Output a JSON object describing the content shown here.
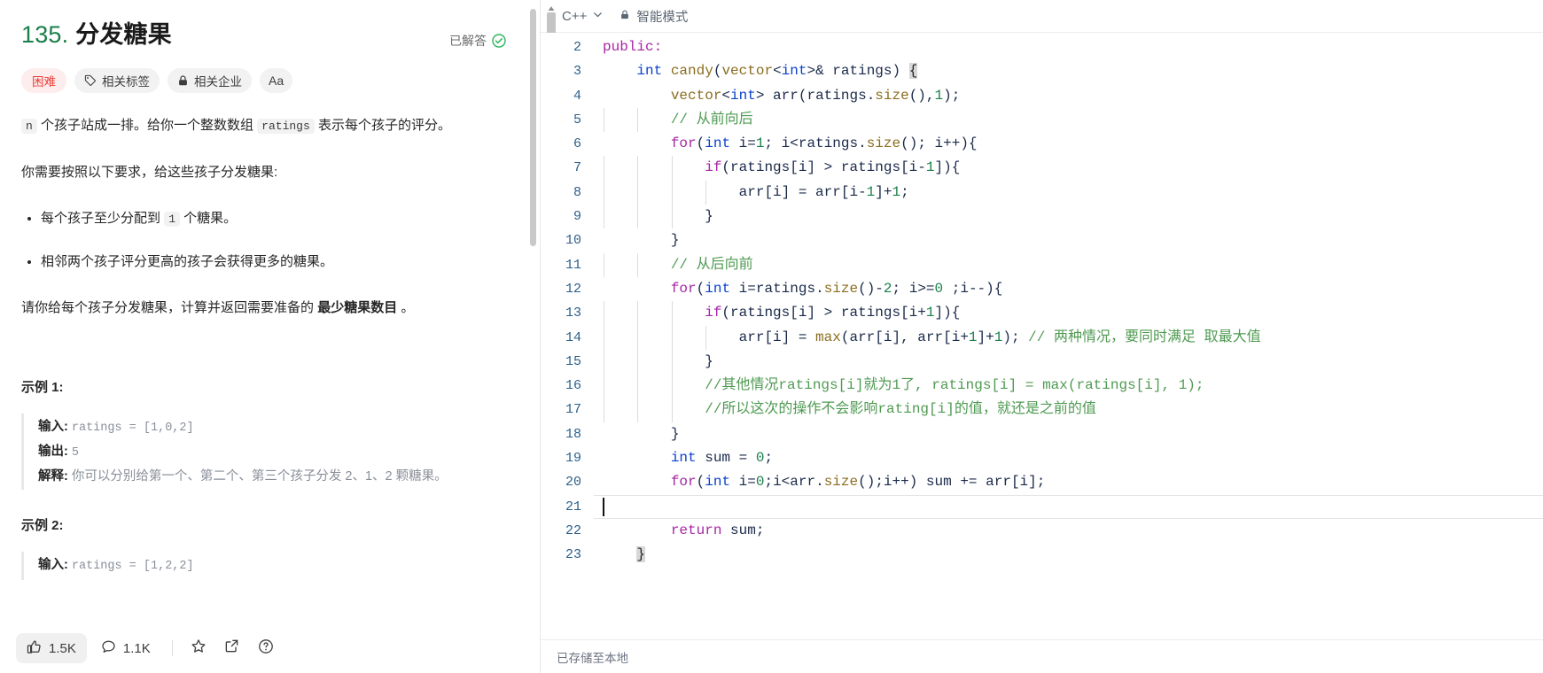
{
  "problem": {
    "number": "135.",
    "title": "分发糖果",
    "solved_label": "已解答",
    "tags": [
      {
        "name": "difficulty-badge",
        "label": "困难",
        "icon": ""
      },
      {
        "name": "topics-button",
        "label": "相关标签",
        "icon": "tag-icon"
      },
      {
        "name": "companies-button",
        "label": "相关企业",
        "icon": "lock-icon"
      },
      {
        "name": "font-size-button",
        "label": "Aa",
        "icon": "font-size-icon"
      }
    ],
    "paragraph_1_pre": "",
    "code_n": "n",
    "paragraph_1_a": "个孩子站成一排。给你一个整数数组",
    "code_ratings": "ratings",
    "paragraph_1_b": "表示每个孩子的评分。",
    "paragraph_2": "你需要按照以下要求，给这些孩子分发糖果:",
    "bullet_1_a": "每个孩子至少分配到",
    "code_one": "1",
    "bullet_1_b": "个糖果。",
    "bullet_2": "相邻两个孩子评分更高的孩子会获得更多的糖果。",
    "paragraph_3_a": "请你给每个孩子分发糖果，计算并返回需要准备的",
    "paragraph_3_bold": "最少糖果数目",
    "paragraph_3_b": "。",
    "examples": [
      {
        "heading": "示例 1:",
        "input_label": "输入:",
        "input_value": "ratings = [1,0,2]",
        "output_label": "输出:",
        "output_value": "5",
        "explain_label": "解释:",
        "explain_value": "你可以分别给第一个、第二个、第三个孩子分发 2、1、2 颗糖果。"
      },
      {
        "heading": "示例 2:",
        "input_label": "输入:",
        "input_value": "ratings = [1,2,2]"
      }
    ]
  },
  "footer": {
    "like_count": "1.5K",
    "comment_count": "1.1K",
    "like_icon": "thumbs-up-icon",
    "comment_icon": "comment-icon",
    "star_icon": "star-icon",
    "share_icon": "share-icon",
    "help_icon": "help-icon"
  },
  "editor": {
    "language": "C++",
    "chevron_icon": "chevron-down-icon",
    "lock_icon": "lock-icon",
    "smart_mode": "智能模式",
    "status": "已存储至本地",
    "first_line_number": 2,
    "cursor_line": 21,
    "lines": [
      {
        "n": 2,
        "indent": 0,
        "tokens": [
          {
            "t": "public:",
            "c": "k"
          }
        ]
      },
      {
        "n": 3,
        "indent": 1,
        "tokens": [
          {
            "t": "int",
            "c": "kt"
          },
          {
            "t": " ",
            "c": "op"
          },
          {
            "t": "candy",
            "c": "fn"
          },
          {
            "t": "(",
            "c": "br"
          },
          {
            "t": "vector",
            "c": "fn"
          },
          {
            "t": "<",
            "c": "op"
          },
          {
            "t": "int",
            "c": "kt"
          },
          {
            "t": ">& ",
            "c": "op"
          },
          {
            "t": "ratings",
            "c": "id"
          },
          {
            "t": ") ",
            "c": "br"
          },
          {
            "t": "{",
            "c": "match"
          }
        ]
      },
      {
        "n": 4,
        "indent": 2,
        "tokens": [
          {
            "t": "vector",
            "c": "fn"
          },
          {
            "t": "<",
            "c": "op"
          },
          {
            "t": "int",
            "c": "kt"
          },
          {
            "t": "> ",
            "c": "op"
          },
          {
            "t": "arr",
            "c": "id"
          },
          {
            "t": "(",
            "c": "br"
          },
          {
            "t": "ratings",
            "c": "id"
          },
          {
            "t": ".",
            "c": "op"
          },
          {
            "t": "size",
            "c": "fn"
          },
          {
            "t": "(),",
            "c": "br"
          },
          {
            "t": "1",
            "c": "num"
          },
          {
            "t": ");",
            "c": "br"
          }
        ]
      },
      {
        "n": 5,
        "indent": 2,
        "guide": true,
        "tokens": [
          {
            "t": "// 从前向后",
            "c": "cm"
          }
        ]
      },
      {
        "n": 6,
        "indent": 2,
        "tokens": [
          {
            "t": "for",
            "c": "k"
          },
          {
            "t": "(",
            "c": "br"
          },
          {
            "t": "int",
            "c": "kt"
          },
          {
            "t": " i=",
            "c": "op"
          },
          {
            "t": "1",
            "c": "num"
          },
          {
            "t": "; i<",
            "c": "op"
          },
          {
            "t": "ratings",
            "c": "id"
          },
          {
            "t": ".",
            "c": "op"
          },
          {
            "t": "size",
            "c": "fn"
          },
          {
            "t": "(); i++){",
            "c": "br"
          }
        ]
      },
      {
        "n": 7,
        "indent": 3,
        "guide": true,
        "tokens": [
          {
            "t": "if",
            "c": "k"
          },
          {
            "t": "(",
            "c": "br"
          },
          {
            "t": "ratings",
            "c": "id"
          },
          {
            "t": "[i] > ",
            "c": "op"
          },
          {
            "t": "ratings",
            "c": "id"
          },
          {
            "t": "[i-",
            "c": "op"
          },
          {
            "t": "1",
            "c": "num"
          },
          {
            "t": "]){",
            "c": "br"
          }
        ]
      },
      {
        "n": 8,
        "indent": 4,
        "guide": true,
        "tokens": [
          {
            "t": "arr",
            "c": "id"
          },
          {
            "t": "[i] = ",
            "c": "op"
          },
          {
            "t": "arr",
            "c": "id"
          },
          {
            "t": "[i-",
            "c": "op"
          },
          {
            "t": "1",
            "c": "num"
          },
          {
            "t": "]+",
            "c": "op"
          },
          {
            "t": "1",
            "c": "num"
          },
          {
            "t": ";",
            "c": "br"
          }
        ]
      },
      {
        "n": 9,
        "indent": 3,
        "guide": true,
        "tokens": [
          {
            "t": "}",
            "c": "br"
          }
        ]
      },
      {
        "n": 10,
        "indent": 2,
        "tokens": [
          {
            "t": "}",
            "c": "br"
          }
        ]
      },
      {
        "n": 11,
        "indent": 2,
        "guide": true,
        "tokens": [
          {
            "t": "// 从后向前",
            "c": "cm"
          }
        ]
      },
      {
        "n": 12,
        "indent": 2,
        "tokens": [
          {
            "t": "for",
            "c": "k"
          },
          {
            "t": "(",
            "c": "br"
          },
          {
            "t": "int",
            "c": "kt"
          },
          {
            "t": " i=",
            "c": "op"
          },
          {
            "t": "ratings",
            "c": "id"
          },
          {
            "t": ".",
            "c": "op"
          },
          {
            "t": "size",
            "c": "fn"
          },
          {
            "t": "()-",
            "c": "br"
          },
          {
            "t": "2",
            "c": "num"
          },
          {
            "t": "; i>=",
            "c": "op"
          },
          {
            "t": "0",
            "c": "num"
          },
          {
            "t": " ;i--){",
            "c": "br"
          }
        ]
      },
      {
        "n": 13,
        "indent": 3,
        "guide": true,
        "tokens": [
          {
            "t": "if",
            "c": "k"
          },
          {
            "t": "(",
            "c": "br"
          },
          {
            "t": "ratings",
            "c": "id"
          },
          {
            "t": "[i] > ",
            "c": "op"
          },
          {
            "t": "ratings",
            "c": "id"
          },
          {
            "t": "[i+",
            "c": "op"
          },
          {
            "t": "1",
            "c": "num"
          },
          {
            "t": "]){",
            "c": "br"
          }
        ]
      },
      {
        "n": 14,
        "indent": 4,
        "guide": true,
        "tokens": [
          {
            "t": "arr",
            "c": "id"
          },
          {
            "t": "[i] = ",
            "c": "op"
          },
          {
            "t": "max",
            "c": "fn"
          },
          {
            "t": "(",
            "c": "br"
          },
          {
            "t": "arr",
            "c": "id"
          },
          {
            "t": "[i], ",
            "c": "op"
          },
          {
            "t": "arr",
            "c": "id"
          },
          {
            "t": "[i+",
            "c": "op"
          },
          {
            "t": "1",
            "c": "num"
          },
          {
            "t": "]+",
            "c": "op"
          },
          {
            "t": "1",
            "c": "num"
          },
          {
            "t": "); ",
            "c": "br"
          },
          {
            "t": "// 两种情况，要同时满足 取最大值",
            "c": "cm"
          }
        ]
      },
      {
        "n": 15,
        "indent": 3,
        "guide": true,
        "tokens": [
          {
            "t": "}",
            "c": "br"
          }
        ]
      },
      {
        "n": 16,
        "indent": 3,
        "guide": true,
        "tokens": [
          {
            "t": "//其他情况ratings[i]就为1了, ratings[i] = max(ratings[i], 1);",
            "c": "cm"
          }
        ]
      },
      {
        "n": 17,
        "indent": 3,
        "guide": true,
        "tokens": [
          {
            "t": "//所以这次的操作不会影响rating[i]的值，就还是之前的值",
            "c": "cm"
          }
        ]
      },
      {
        "n": 18,
        "indent": 2,
        "tokens": [
          {
            "t": "}",
            "c": "br"
          }
        ]
      },
      {
        "n": 19,
        "indent": 2,
        "tokens": [
          {
            "t": "int",
            "c": "kt"
          },
          {
            "t": " sum = ",
            "c": "op"
          },
          {
            "t": "0",
            "c": "num"
          },
          {
            "t": ";",
            "c": "br"
          }
        ]
      },
      {
        "n": 20,
        "indent": 2,
        "tokens": [
          {
            "t": "for",
            "c": "k"
          },
          {
            "t": "(",
            "c": "br"
          },
          {
            "t": "int",
            "c": "kt"
          },
          {
            "t": " i=",
            "c": "op"
          },
          {
            "t": "0",
            "c": "num"
          },
          {
            "t": ";i<",
            "c": "op"
          },
          {
            "t": "arr",
            "c": "id"
          },
          {
            "t": ".",
            "c": "op"
          },
          {
            "t": "size",
            "c": "fn"
          },
          {
            "t": "();i++) sum += ",
            "c": "br"
          },
          {
            "t": "arr",
            "c": "id"
          },
          {
            "t": "[i];",
            "c": "op"
          }
        ]
      },
      {
        "n": 21,
        "indent": 0,
        "cursor": true,
        "tokens": []
      },
      {
        "n": 22,
        "indent": 2,
        "tokens": [
          {
            "t": "return",
            "c": "k"
          },
          {
            "t": " sum;",
            "c": "op"
          }
        ]
      },
      {
        "n": 23,
        "indent": 1,
        "tokens": [
          {
            "t": "}",
            "c": "match"
          }
        ]
      }
    ]
  },
  "colors": {
    "keyword": "#a626a4",
    "type": "#0b41cd",
    "function": "#8a6d1f",
    "number": "#1a7f4b",
    "comment": "#4f9a52",
    "identifier": "#1a2a4a",
    "difficulty": "#e8403a",
    "solved_check": "#2db55d"
  }
}
